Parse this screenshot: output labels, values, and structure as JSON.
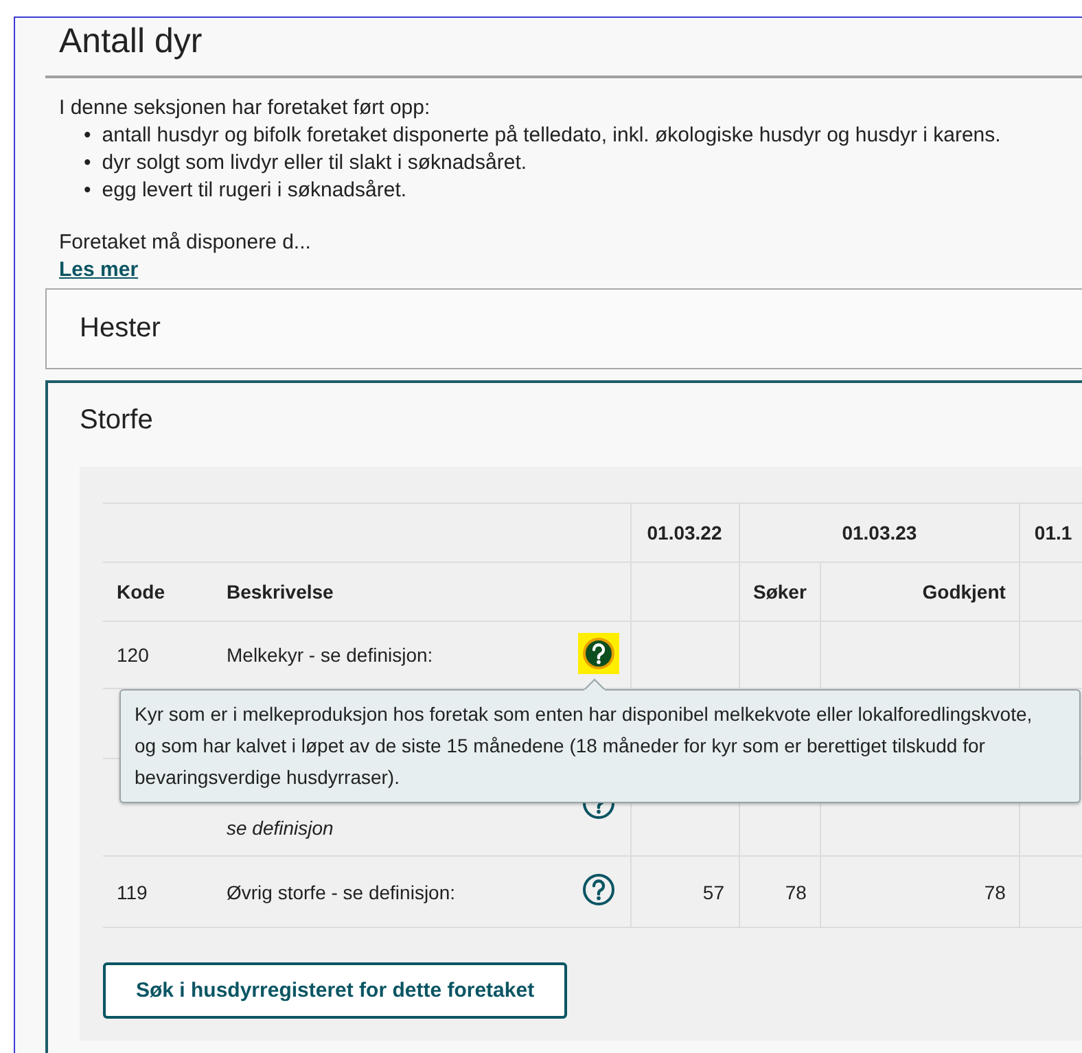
{
  "heading": "Antall dyr",
  "intro": {
    "marker": "•",
    "lead": "I denne seksjonen har foretaket ført opp:",
    "bullets": [
      "antall husdyr og bifolk foretaket disponerte på telledato, inkl. økologiske husdyr og husdyr i karens.",
      "dyr solgt som livdyr eller til slakt i søknadsåret.",
      "egg levert til rugeri i søknadsåret."
    ],
    "summary": "Foretaket må disponere d...",
    "link": "Les mer"
  },
  "panels": [
    {
      "title": "Hester",
      "expanded": false
    },
    {
      "title": "Storfe",
      "expanded": true,
      "table": {
        "code_header": "Kode",
        "description_header": "Beskrivelse",
        "date_groups": [
          {
            "date": "01.03.22"
          },
          {
            "date": "01.03.23",
            "columns": [
              "Søker",
              "Godkjent"
            ]
          },
          {
            "date": "01.1"
          }
        ],
        "rows": [
          {
            "kind": "item",
            "code": "120",
            "description": "Melkekyr - se definisjon:",
            "help_active": true
          },
          {
            "kind": "covered"
          },
          {
            "kind": "partial",
            "description": "se definisjon",
            "help_active": false
          },
          {
            "kind": "item",
            "code": "119",
            "description": "Øvrig storfe - se definisjon:",
            "help_active": false,
            "values": [
              "57",
              "78",
              "78"
            ]
          }
        ]
      },
      "tooltip": "Kyr som er i melkeproduksjon hos foretak som enten har disponibel melkekvote eller lokalforedlingskvote, og som har kalvet i løpet av de siste 15 månedene (18 måneder for kyr som er berettiget tilskudd for bevaringsverdige husdyrraser).",
      "button": "Søk i husdyrregisteret for dette foretaket"
    }
  ]
}
